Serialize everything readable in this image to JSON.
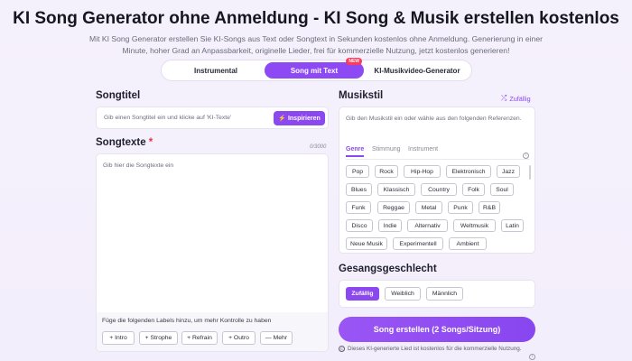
{
  "page": {
    "title": "KI Song Generator ohne Anmeldung - KI Song & Musik erstellen kostenlos",
    "description": "Mit KI Song Generator erstellen Sie KI-Songs aus Text oder Songtext in Sekunden kostenlos ohne Anmeldung. Generierung in einer Minute, hoher Grad an Anpassbarkeit, originelle Lieder, frei für kommerzielle Nutzung, jetzt kostenlos generieren!"
  },
  "tabs": [
    {
      "label": "Instrumental"
    },
    {
      "label": "Song mit Text",
      "badge": "NEW"
    },
    {
      "label": "KI-Musikvideo-Generator"
    }
  ],
  "song_title": {
    "label": "Songtitel",
    "placeholder": "Gib einen Songtitel ein und klicke auf 'KI-Texte'",
    "inspire_label": "Inspirieren"
  },
  "lyrics": {
    "label": "Songtexte",
    "required_mark": "*",
    "counter": "0/3000",
    "placeholder": "Gib hier die Songtexte ein",
    "labels_hint": "Füge die folgenden Labels hinzu, um mehr Kontrolle zu haben",
    "label_buttons": [
      "+ Intro",
      "+ Strophe",
      "+ Refrain",
      "+ Outro",
      "— Mehr"
    ]
  },
  "style": {
    "label": "Musikstil",
    "random_label": "Zufällig",
    "placeholder": "Gib den Musikstil ein oder wähle aus den folgenden Referenzen.",
    "subtabs": [
      "Genre",
      "Stimmung",
      "Instrument"
    ],
    "genres": [
      "Pop",
      "Rock",
      "Hip-Hop",
      "Elektronisch",
      "Jazz",
      "Blues",
      "Klassisch",
      "Country",
      "Folk",
      "Soul",
      "Funk",
      "Reggae",
      "Metal",
      "Punk",
      "R&B",
      "Disco",
      "Indie",
      "Alternativ",
      "Weltmusik",
      "Latin",
      "Neue Musik",
      "Experimentell",
      "Ambient"
    ]
  },
  "gender": {
    "label": "Gesangsgeschlecht",
    "options": [
      "Zufällig",
      "Weiblich",
      "Männlich"
    ]
  },
  "create_button": "Song erstellen (2 Songs/Sitzung)",
  "footer_note": "Dieses KI-generierte Lied ist kostenlos für die kommerzielle Nutzung.",
  "colors": {
    "accent": "#8b48f1",
    "badge": "#ff3a5a",
    "required": "#e8334a"
  }
}
